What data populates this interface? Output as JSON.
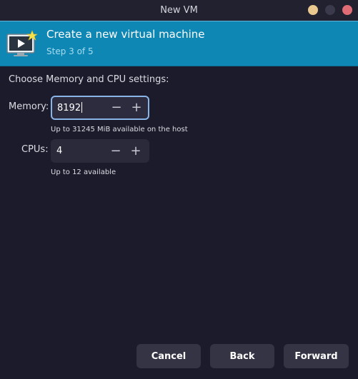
{
  "window": {
    "title": "New VM"
  },
  "banner": {
    "title": "Create a new virtual machine",
    "step": "Step 3 of 5",
    "icon": "vm-screen-icon"
  },
  "section": {
    "label": "Choose Memory and CPU settings:"
  },
  "memory": {
    "label": "Memory:",
    "value": "8192",
    "hint": "Up to 31245 MiB available on the host",
    "minus": "−",
    "plus": "+"
  },
  "cpus": {
    "label": "CPUs:",
    "value": "4",
    "hint": "Up to 12 available",
    "minus": "−",
    "plus": "+"
  },
  "buttons": {
    "cancel": "Cancel",
    "back": "Back",
    "forward": "Forward"
  },
  "colors": {
    "accent": "#0f87b5",
    "background": "#1c1b2b",
    "focus_border": "#89b4e8"
  }
}
